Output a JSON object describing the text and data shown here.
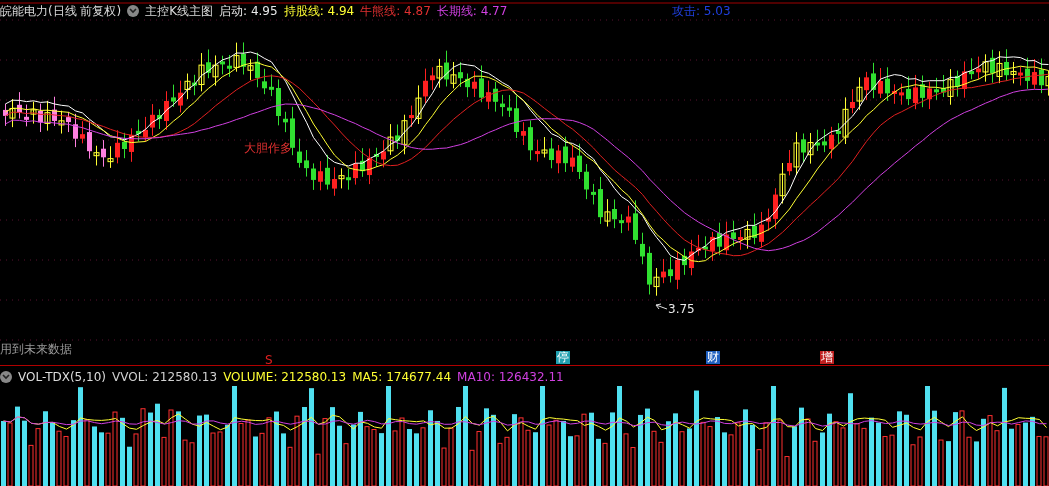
{
  "main_chart": {
    "stock_title": "皖能电力(日线 前复权)",
    "indicator_name": "主控K线主图",
    "readings": [
      {
        "label": "启动:",
        "value": "4.95",
        "color": "#e8e8e8"
      },
      {
        "label": "持股线:",
        "value": "4.94",
        "color": "#ffff33"
      },
      {
        "label": "牛熊线:",
        "value": "4.87",
        "color": "#e03030"
      },
      {
        "label": "长期线:",
        "value": "4.77",
        "color": "#d040e0"
      }
    ],
    "attack": {
      "label": "攻击:",
      "value": "5.03",
      "color": "#2040e0"
    },
    "signal_text": "大胆作多",
    "low_price": "3.75",
    "future_data_note": "用到未来数据",
    "event_markers": [
      {
        "text": "S",
        "kind": "text",
        "color": "#e02020"
      },
      {
        "text": "停",
        "kind": "tag",
        "color": "#20a0b0"
      },
      {
        "text": "财",
        "kind": "tag",
        "color": "#2060c0"
      },
      {
        "text": "增",
        "kind": "tag",
        "color": "#c02020"
      }
    ]
  },
  "volume_chart": {
    "indicator_name": "VOL-TDX(5,10)",
    "readings": [
      {
        "label": "VVOL:",
        "value": "212580.13",
        "color": "#d0d0d0"
      },
      {
        "label": "VOLUME:",
        "value": "212580.13",
        "color": "#ffff33"
      },
      {
        "label": "MA5:",
        "value": "174677.44",
        "color": "#ffff33"
      },
      {
        "label": "MA10:",
        "value": "126432.11",
        "color": "#d040e0"
      }
    ]
  }
}
